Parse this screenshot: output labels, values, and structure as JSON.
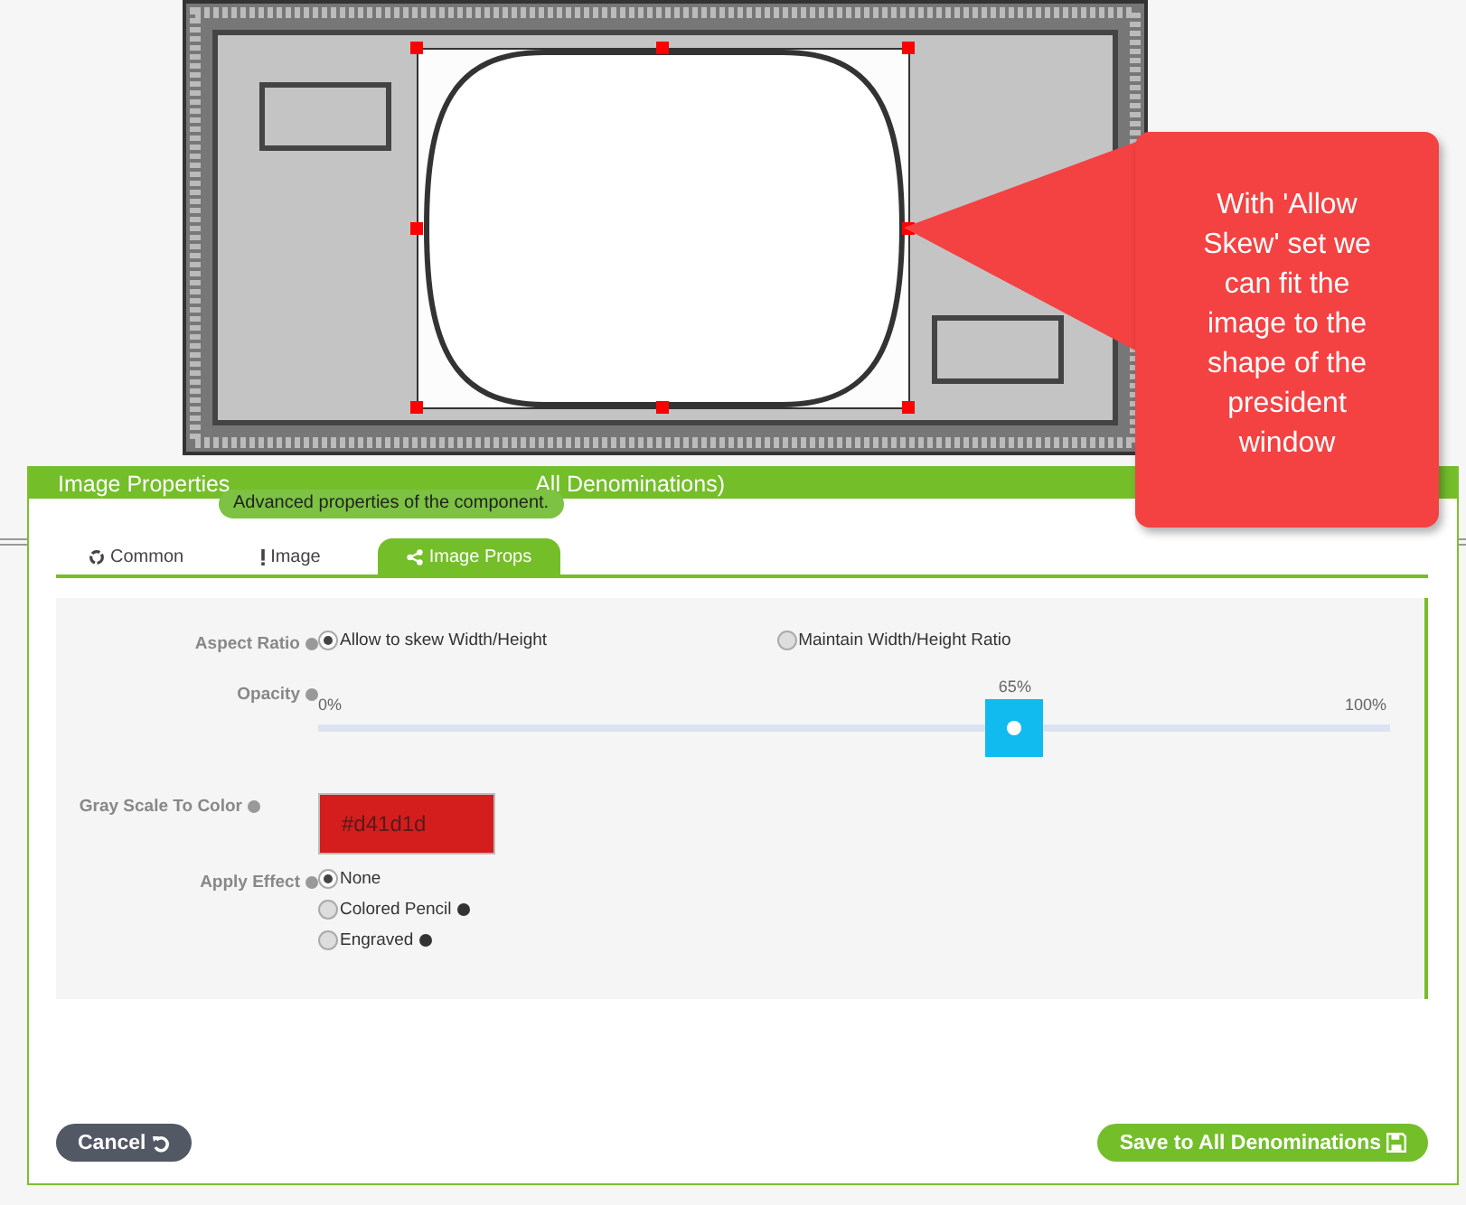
{
  "callout": {
    "text": "With 'Allow Skew' set we can fit the image to the shape of the president window"
  },
  "dialog": {
    "title_start": "Image Properties",
    "title_end": "All Denominations)",
    "tooltip": "Advanced properties of the component.",
    "tabs": [
      {
        "label": "Common",
        "selected": false
      },
      {
        "label": "Image",
        "selected": false
      },
      {
        "label": "Image Props",
        "selected": true
      }
    ],
    "aspect_ratio": {
      "label": "Aspect Ratio",
      "options": [
        {
          "label": "Allow to skew Width/Height",
          "selected": true
        },
        {
          "label": "Maintain Width/Height Ratio",
          "selected": false
        }
      ]
    },
    "opacity": {
      "label": "Opacity",
      "min": "0%",
      "reading": "65%",
      "max": "100%",
      "level": 0.65
    },
    "gray_scale": {
      "label": "Gray Scale To Color",
      "value": "#d41d1d",
      "color": "#d41d1d"
    },
    "apply_effect": {
      "label": "Apply Effect",
      "options": [
        {
          "label": "None",
          "selected": true,
          "help": false
        },
        {
          "label": "Colored Pencil",
          "selected": false,
          "help": true
        },
        {
          "label": "Engraved",
          "selected": false,
          "help": true
        }
      ]
    },
    "buttons": {
      "cancel": "Cancel",
      "save": "Save to All Denominations"
    }
  }
}
